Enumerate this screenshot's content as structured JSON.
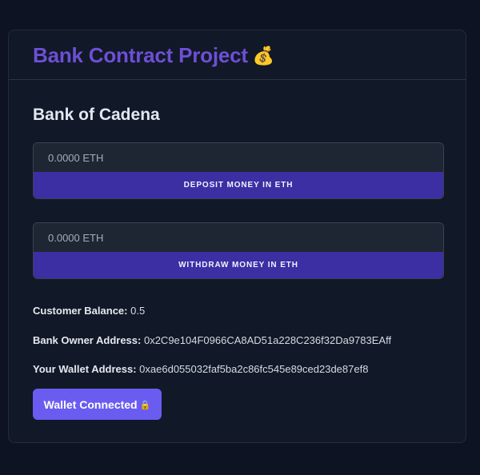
{
  "header": {
    "title": "Bank Contract Project",
    "title_emoji": "💰",
    "title_emoji_icon": "money-bag-icon"
  },
  "bank": {
    "name": "Bank of Cadena"
  },
  "deposit": {
    "placeholder": "0.0000 ETH",
    "value": "",
    "button_label": "DEPOSIT MONEY IN ETH"
  },
  "withdraw": {
    "placeholder": "0.0000 ETH",
    "value": "",
    "button_label": "WITHDRAW MONEY IN ETH"
  },
  "info": {
    "balance_label": "Customer Balance:",
    "balance_value": "0.5",
    "owner_label": "Bank Owner Address:",
    "owner_value": "0x2C9e104F0966CA8AD51a228C236f32Da9783EAff",
    "wallet_label": "Your Wallet Address:",
    "wallet_value": "0xae6d055032faf5ba2c86fc545e89ced23de87ef8"
  },
  "wallet_button": {
    "label": "Wallet Connected",
    "icon_glyph": "🔒",
    "icon": "lock-icon"
  },
  "colors": {
    "page_background": "#0d1322",
    "card_background": "#111827",
    "title_accent": "#6d4fd6",
    "action_button": "#3b2fa3",
    "wallet_button": "#6a5cf0"
  }
}
